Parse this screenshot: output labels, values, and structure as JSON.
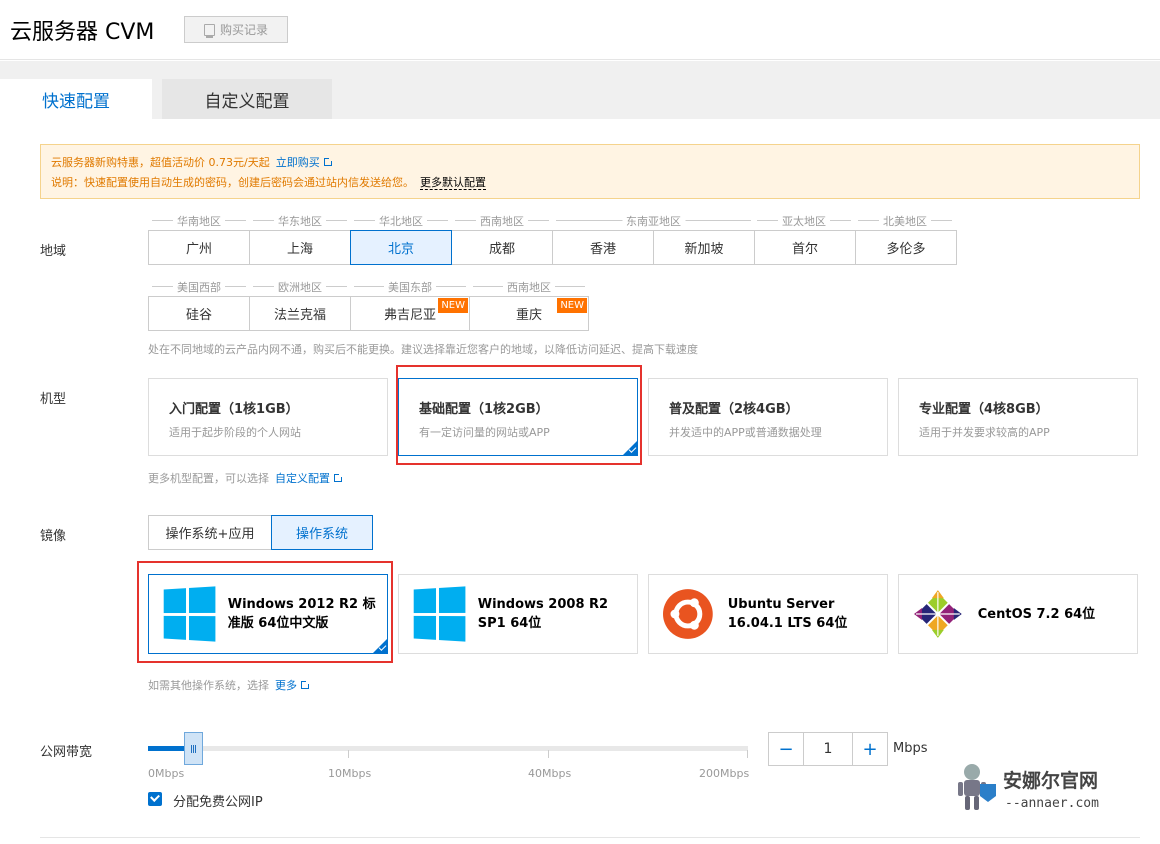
{
  "header": {
    "title": "云服务器 CVM",
    "record_button": "购买记录"
  },
  "tabs": [
    {
      "label": "快速配置",
      "active": true
    },
    {
      "label": "自定义配置",
      "active": false
    }
  ],
  "notice": {
    "line1": "云服务器新购特惠，超值活动价 0.73元/天起",
    "line1_link": "立即购买",
    "line2": "说明：快速配置使用自动生成的密码，创建后密码会通过站内信发送给您。",
    "line2_link": "更多默认配置"
  },
  "region": {
    "label": "地域",
    "row1_groups": [
      "华南地区",
      "华东地区",
      "华北地区",
      "西南地区",
      "东南亚地区",
      "亚太地区",
      "北美地区"
    ],
    "row1": [
      "广州",
      "上海",
      "北京",
      "成都",
      "香港",
      "新加坡",
      "首尔",
      "多伦多"
    ],
    "row2_groups": [
      "美国西部",
      "欧洲地区",
      "美国东部",
      "西南地区"
    ],
    "row2": [
      "硅谷",
      "法兰克福",
      "弗吉尼亚",
      "重庆"
    ],
    "selected": "北京",
    "new_badge": "NEW",
    "hint": "处在不同地域的云产品内网不通，购买后不能更换。建议选择靠近您客户的地域，以降低访问延迟、提高下载速度"
  },
  "machine": {
    "label": "机型",
    "cards": [
      {
        "title": "入门配置（1核1GB）",
        "desc": "适用于起步阶段的个人网站"
      },
      {
        "title": "基础配置（1核2GB）",
        "desc": "有一定访问量的网站或APP"
      },
      {
        "title": "普及配置（2核4GB）",
        "desc": "并发适中的APP或普通数据处理"
      },
      {
        "title": "专业配置（4核8GB）",
        "desc": "适用于并发要求较高的APP"
      }
    ],
    "hint": "更多机型配置，可以选择",
    "hint_link": "自定义配置"
  },
  "image": {
    "label": "镜像",
    "types": [
      "操作系统+应用",
      "操作系统"
    ],
    "os": [
      {
        "name": "Windows 2012 R2 标准版 64位中文版",
        "icon": "windows-icon"
      },
      {
        "name": "Windows 2008 R2 SP1 64位",
        "icon": "windows-icon"
      },
      {
        "name": "Ubuntu Server 16.04.1 LTS 64位",
        "icon": "ubuntu-icon"
      },
      {
        "name": "CentOS 7.2 64位",
        "icon": "centos-icon"
      }
    ],
    "hint": "如需其他操作系统，选择",
    "hint_link": "更多"
  },
  "bandwidth": {
    "label": "公网带宽",
    "ticks": [
      "0Mbps",
      "10Mbps",
      "40Mbps",
      "200Mbps"
    ],
    "value": "1",
    "unit": "Mbps",
    "minus": "−",
    "plus": "+",
    "free_ip": "分配免费公网IP"
  },
  "watermark": {
    "title": "安娜尔官网",
    "sub": "--annaer.com"
  },
  "colors": {
    "accent": "#0071ce",
    "highlight": "#e5322d",
    "badge": "#ff7200"
  }
}
